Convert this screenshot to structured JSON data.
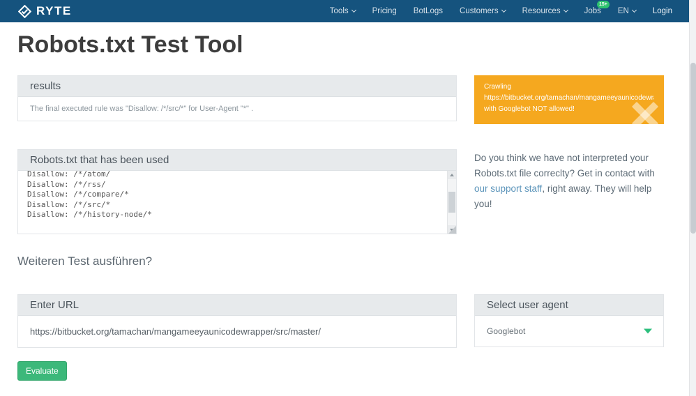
{
  "colors": {
    "navbar_blue": "#15537e",
    "accent_green": "#3cb87a",
    "alert_orange": "#f5a81f",
    "link_blue": "#5b94ba"
  },
  "nav": {
    "brand": "RYTE",
    "items": [
      {
        "label": "Tools"
      },
      {
        "label": "Pricing"
      },
      {
        "label": "BotLogs"
      },
      {
        "label": "Customers"
      },
      {
        "label": "Resources"
      },
      {
        "label": "Jobs",
        "badge": "15+"
      },
      {
        "label": "EN"
      },
      {
        "label": "Login"
      }
    ]
  },
  "page": {
    "title": "Robots.txt Test Tool"
  },
  "results": {
    "header": "results",
    "text": "The final executed rule was \"Disallow: /*/src/*\" for User-Agent \"*\" ."
  },
  "alert": {
    "line1": "Crawling",
    "line2": "https://bitbucket.org/tamachan/mangameeyaunicodewrapper/src/master/",
    "line3": "with Googlebot NOT allowed!"
  },
  "robots": {
    "header": "Robots.txt that has been used",
    "content": "Disallow: /*/atom/\nDisallow: /*/rss/\nDisallow: /*/compare/*\nDisallow: /*/src/*\nDisallow: /*/history-node/*"
  },
  "help": {
    "text_before": "Do you think we have not interpreted your Robots.txt file correclty? Get in contact with ",
    "link": "our support staff",
    "text_after": ", right away. They will help you!"
  },
  "retest": {
    "label": "Weiteren Test ausführen?"
  },
  "url_panel": {
    "header": "Enter URL",
    "value": "https://bitbucket.org/tamachan/mangameeyaunicodewrapper/src/master/"
  },
  "agent_panel": {
    "header": "Select user agent",
    "value": "Googlebot"
  },
  "evaluate": {
    "label": "Evaluate"
  }
}
